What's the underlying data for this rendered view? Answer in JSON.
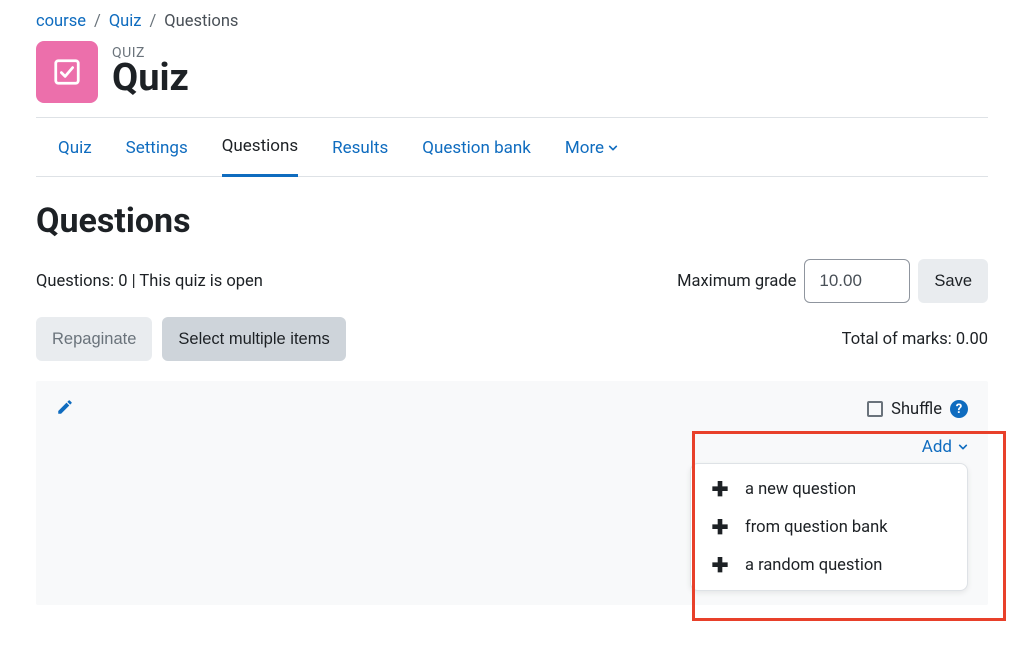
{
  "breadcrumb": {
    "items": [
      "course",
      "Quiz"
    ],
    "current": "Questions"
  },
  "activity": {
    "type_label": "QUIZ",
    "title": "Quiz"
  },
  "tabs": {
    "items": [
      {
        "label": "Quiz"
      },
      {
        "label": "Settings"
      },
      {
        "label": "Questions"
      },
      {
        "label": "Results"
      },
      {
        "label": "Question bank"
      },
      {
        "label": "More"
      }
    ],
    "active_index": 2,
    "more_index": 5
  },
  "heading": "Questions",
  "status": {
    "text": "Questions: 0 | This quiz is open",
    "max_grade_label": "Maximum grade",
    "max_grade_value": "10.00",
    "save_label": "Save"
  },
  "toolbar": {
    "repaginate_label": "Repaginate",
    "select_multiple_label": "Select multiple items",
    "total_marks_label": "Total of marks: 0.00"
  },
  "shuffle": {
    "label": "Shuffle"
  },
  "add_menu": {
    "toggle_label": "Add",
    "items": [
      {
        "label": "a new question"
      },
      {
        "label": "from question bank"
      },
      {
        "label": "a random question"
      }
    ]
  }
}
